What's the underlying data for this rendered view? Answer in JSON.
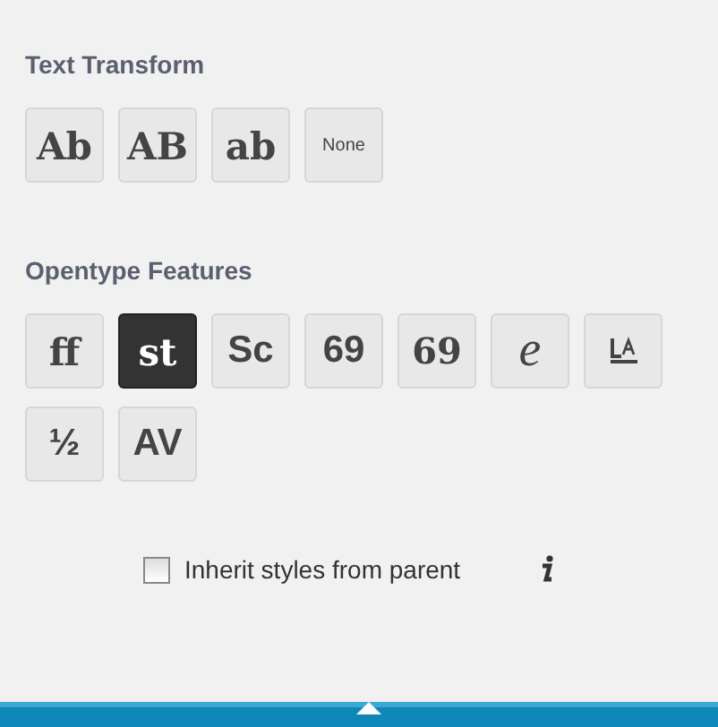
{
  "sections": [
    {
      "title": "Text Transform",
      "buttons": [
        {
          "kind": "text",
          "label": "Ab",
          "selected": false
        },
        {
          "kind": "text",
          "label": "AB",
          "selected": false
        },
        {
          "kind": "text",
          "label": "ab",
          "selected": false
        },
        {
          "kind": "text",
          "label": "None",
          "selected": false
        }
      ]
    },
    {
      "title": "Opentype Features",
      "buttons": [
        {
          "kind": "text",
          "label": "ff",
          "selected": false
        },
        {
          "kind": "text",
          "label": "st",
          "selected": true
        },
        {
          "kind": "text",
          "label": "Sc",
          "selected": false
        },
        {
          "kind": "text",
          "label": "69",
          "selected": false
        },
        {
          "kind": "text",
          "label": "69",
          "selected": false
        },
        {
          "kind": "text",
          "label": "e",
          "selected": false
        },
        {
          "kind": "icon",
          "selected": false
        },
        {
          "kind": "text",
          "label": "½",
          "selected": false
        },
        {
          "kind": "text",
          "label": "AV",
          "selected": false
        }
      ]
    }
  ],
  "inherit": {
    "label": "Inherit styles from parent",
    "checked": false
  }
}
